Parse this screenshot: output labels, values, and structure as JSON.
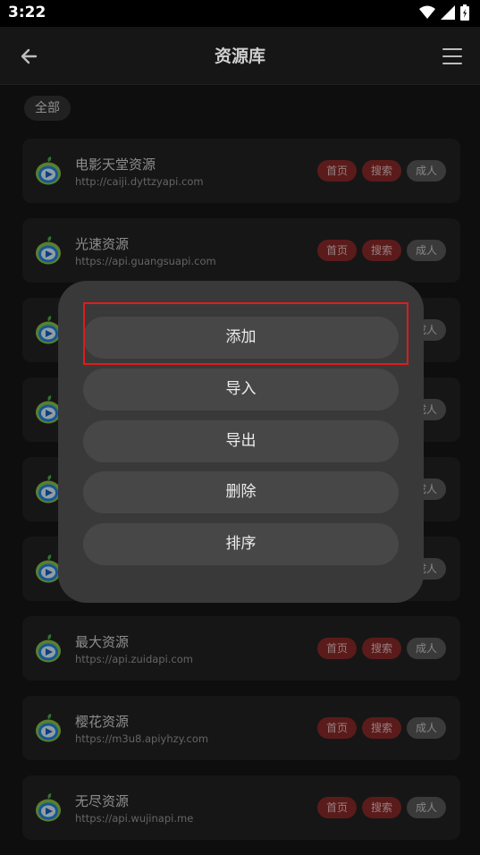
{
  "status": {
    "time": "3:22"
  },
  "header": {
    "title": "资源库"
  },
  "filter": {
    "chip_all": "全部"
  },
  "tags": {
    "home": "首页",
    "search": "搜索",
    "adult": "成人"
  },
  "colors": {
    "tag_red": "#8d2a2a",
    "tag_gray": "#5a5a5a",
    "highlight": "#e01b1b"
  },
  "sources": [
    {
      "name": "电影天堂资源",
      "url": "http://caiji.dyttzyapi.com"
    },
    {
      "name": "光速资源",
      "url": "https://api.guangsuapi.com"
    },
    {
      "name": "",
      "url": ""
    },
    {
      "name": "",
      "url": ""
    },
    {
      "name": "",
      "url": ""
    },
    {
      "name": "",
      "url": ""
    },
    {
      "name": "最大资源",
      "url": "https://api.zuidapi.com"
    },
    {
      "name": "樱花资源",
      "url": "https://m3u8.apiyhzy.com"
    },
    {
      "name": "无尽资源",
      "url": "https://api.wujinapi.me"
    }
  ],
  "dialog": {
    "add": "添加",
    "import": "导入",
    "export": "导出",
    "delete": "删除",
    "sort": "排序"
  }
}
